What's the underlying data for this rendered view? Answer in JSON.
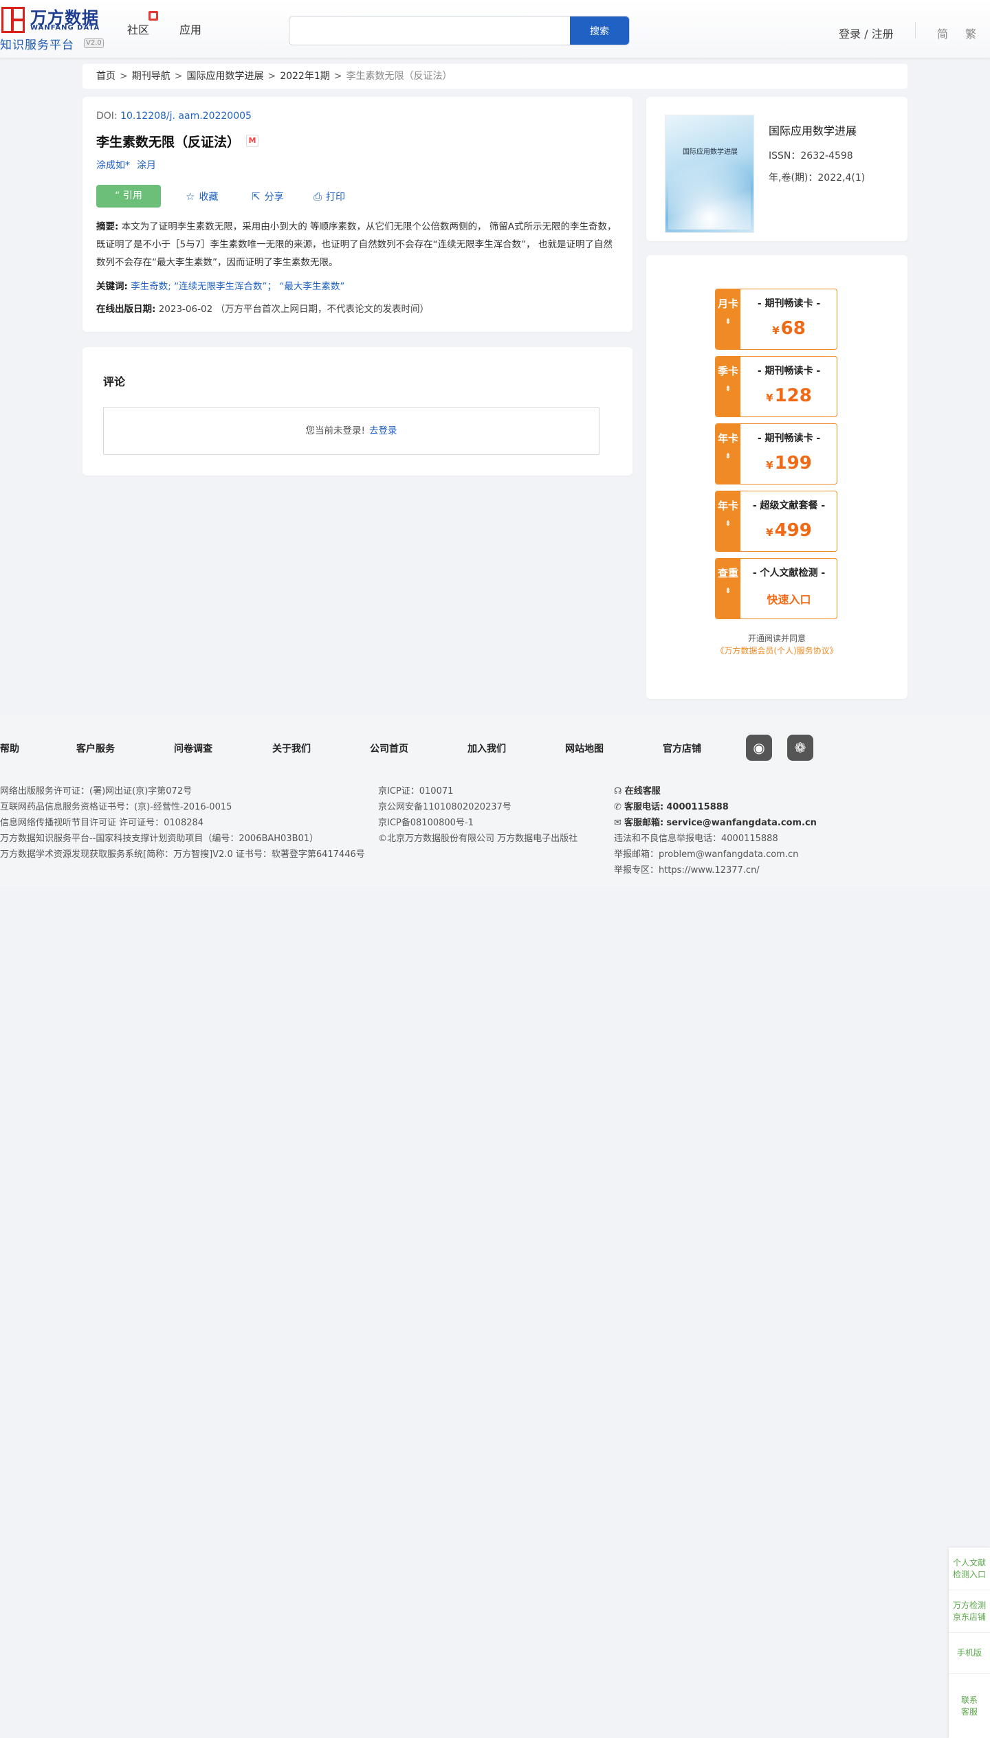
{
  "header": {
    "logo_cn": "万方数据",
    "logo_en": "WANFANG DATA",
    "platform": "知识服务平台",
    "version": "V2.0",
    "nav": [
      "社区",
      "应用"
    ],
    "search_placeholder": "",
    "search_button": "搜索",
    "login": "登录 / 注册",
    "lang_simplified": "简",
    "lang_traditional": "繁"
  },
  "breadcrumb": [
    "首页",
    "期刊导航",
    "国际应用数学进展",
    "2022年1期",
    "李生素数无限（反证法）"
  ],
  "breadcrumb_sep": ">",
  "article": {
    "doi_label": "DOI: ",
    "doi": "10.12208/j. aam.20220005",
    "title": "李生素数无限（反证法）",
    "m_icon": "M",
    "authors": [
      "涂成如*",
      "涂月"
    ],
    "cite": "“ 引用",
    "actions": {
      "favorite": "收藏",
      "share": "分享",
      "print": "打印"
    },
    "abstract_label": "摘要:",
    "abstract": "本文为了证明李生素数无限，采用由小到大的 等顺序素数，从它们无限个公倍数两侧的， 筛留A式所示无限的李生奇数，既证明了是不小于［5与7］李生素数唯一无限的来源，也证明了自然数列不会存在“连续无限李生浑合数”， 也就是证明了自然数列不会存在“最大李生素数”，因而证明了李生素数无限。",
    "keywords_label": "关键词:",
    "keywords": [
      "李生奇数;",
      "“连续无限李生浑合数”；",
      "“最大李生素数”"
    ],
    "pubdate_label": "在线出版日期:",
    "pubdate": "2023-06-02",
    "pubdate_note": "（万方平台首次上网日期，不代表论文的发表时间）"
  },
  "comment": {
    "title": "评论",
    "not_logged_in": "您当前未登录!",
    "login_link": "去登录"
  },
  "journal": {
    "cover_title": "国际应用数学进展",
    "name": "国际应用数学进展",
    "issn": "ISSN：2632-4598",
    "volume": "年,卷(期)：2022,4(1)"
  },
  "vip": {
    "cards": [
      {
        "tag": "月卡",
        "name": "- 期刊畅读卡 -",
        "yen": "¥",
        "price": "68"
      },
      {
        "tag": "季卡",
        "name": "- 期刊畅读卡 -",
        "yen": "¥",
        "price": "128"
      },
      {
        "tag": "年卡",
        "name": "- 期刊畅读卡 -",
        "yen": "¥",
        "price": "199"
      },
      {
        "tag": "年卡",
        "name": "- 超级文献套餐 -",
        "yen": "¥",
        "price": "499"
      }
    ],
    "check": {
      "tag": "查重",
      "name": "- 个人文献检测 -",
      "entry": "快速入口"
    },
    "arrow": "⇟",
    "agree_line1": "开通阅读并同意",
    "agree_link": "《万方数据会员(个人)服务协议》"
  },
  "footer": {
    "links": [
      "帮助",
      "客户服务",
      "问卷调查",
      "关于我们",
      "公司首页",
      "加入我们",
      "网站地图",
      "官方店铺"
    ],
    "col1": [
      "网络出版服务许可证：(署)网出证(京)字第072号",
      "互联网药品信息服务资格证书号：(京)-经营性-2016-0015",
      "信息网络传播视听节目许可证 许可证号：0108284",
      "万方数据知识服务平台--国家科技支撑计划资助项目（编号：2006BAH03B01）",
      "万方数据学术资源发现获取服务系统[简称：万方智搜]V2.0 证书号：软著登字第6417446号"
    ],
    "col2": [
      "京ICP证：010071",
      "京公网安备11010802020237号",
      "京ICP备08100800号-1",
      "©北京万方数据股份有限公司 万方数据电子出版社"
    ],
    "col3": {
      "online_service": "在线客服",
      "phone_label": "客服电话:",
      "phone": "4000115888",
      "email_label": "客服邮箱:",
      "email": "service@wanfangdata.com.cn",
      "report_phone": "违法和不良信息举报电话：4000115888",
      "report_email": "举报邮箱：problem@wanfangdata.com.cn",
      "report_zone": "举报专区：https://www.12377.cn/"
    }
  },
  "side": [
    "个人文献检测入口",
    "万方检测京东店铺",
    "手机版",
    "联系客服"
  ]
}
